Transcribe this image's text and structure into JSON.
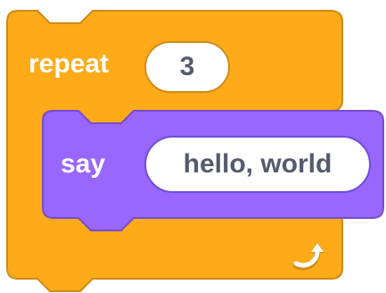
{
  "repeat_block": {
    "keyword": "repeat",
    "count": "3",
    "color": "#ffab19",
    "border_color": "#cf8b17"
  },
  "say_block": {
    "keyword": "say",
    "message": "hello, world",
    "color": "#9966ff",
    "border_color": "#774dcb"
  },
  "loop_arrow_icon": "curved-loop-arrow"
}
